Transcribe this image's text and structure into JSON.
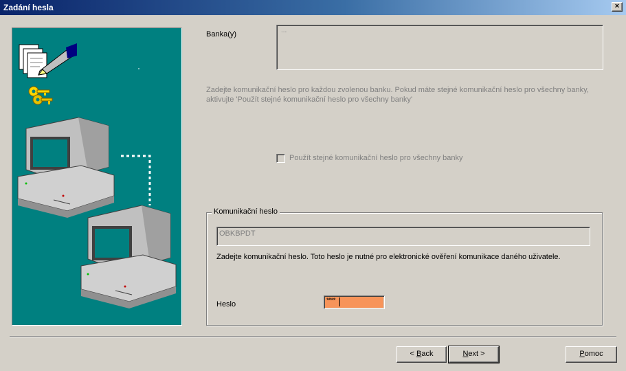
{
  "window": {
    "title": "Zadání hesla",
    "close_label": "×"
  },
  "banks": {
    "label": "Banka(y)",
    "list_value": "..."
  },
  "hint": {
    "line1": "Zadejte komunikační heslo pro každou zvolenou banku. Pokud máte stejné komunikační heslo pro všechny banky,",
    "line2": "aktivujte 'Použít stejné komunikační heslo pro všechny banky'"
  },
  "same_password": {
    "label": "Použít stejné komunikační heslo pro všechny banky",
    "checked": false
  },
  "comm_group": {
    "title": "Komunikační heslo",
    "user_value": "OBKBPDT",
    "description": "Zadejte komunikační heslo. Toto heslo je nutné pro elektronické ověření komunikace daného uživatele.",
    "password_label": "Heslo",
    "password_mask": "*****"
  },
  "buttons": {
    "back_prefix": "< ",
    "back_mnemonic": "B",
    "back_rest": "ack",
    "next_mnemonic": "N",
    "next_rest": "ext >",
    "help_mnemonic": "P",
    "help_rest": "omoc"
  },
  "colors": {
    "titlebar_start": "#0a246a",
    "panel_bg": "#008080",
    "dialog_bg": "#d4d0c8",
    "password_field_bg": "#f7945a"
  },
  "icons": [
    "documents-pen-icon",
    "keys-icon",
    "computer-icon",
    "computer-icon"
  ]
}
